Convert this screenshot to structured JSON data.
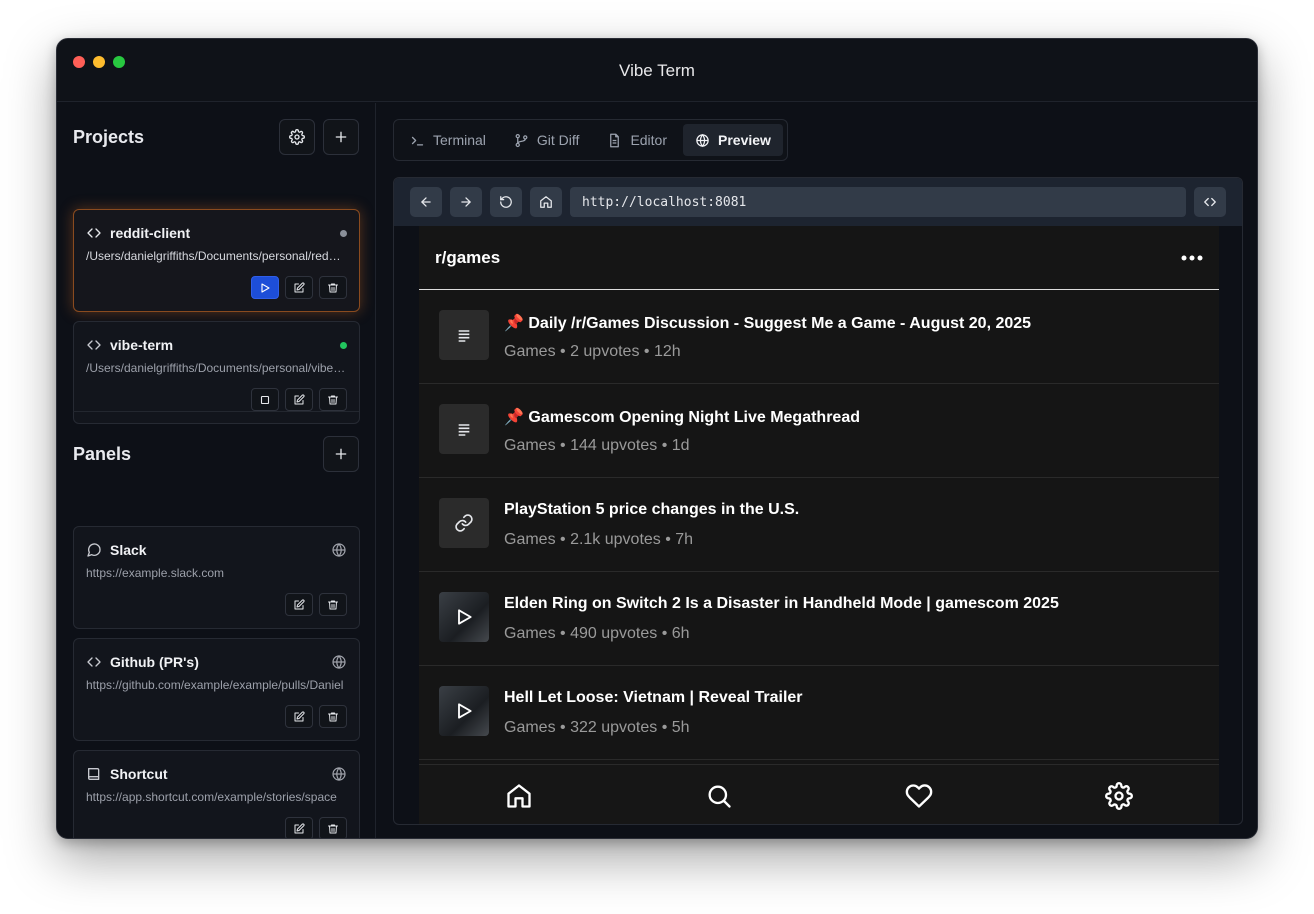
{
  "window": {
    "title": "Vibe Term",
    "traffic_lights": [
      {
        "name": "close",
        "color": "#ff5f57"
      },
      {
        "name": "minimize",
        "color": "#febc2e"
      },
      {
        "name": "zoom",
        "color": "#28c840"
      }
    ]
  },
  "sidebar": {
    "projects": {
      "title": "Projects",
      "settings_icon": "gear-icon",
      "add_icon": "plus-icon",
      "items": [
        {
          "name": "reddit-client",
          "path": "/Users/danielgriffiths/Documents/personal/reddit-client",
          "status_color": "#8a8f99",
          "active": true,
          "run_icon": "play-icon"
        },
        {
          "name": "vibe-term",
          "path": "/Users/danielgriffiths/Documents/personal/vibe-term",
          "status_color": "#22c55e",
          "active": false,
          "run_icon": "stop-icon"
        }
      ]
    },
    "panels": {
      "title": "Panels",
      "add_icon": "plus-icon",
      "items": [
        {
          "name": "Slack",
          "url": "https://example.slack.com",
          "icon": "chat-bubble-icon"
        },
        {
          "name": "Github (PR's)",
          "url": "https://github.com/example/example/pulls/Daniel",
          "icon": "code-icon"
        },
        {
          "name": "Shortcut",
          "url": "https://app.shortcut.com/example/stories/space",
          "icon": "book-icon"
        }
      ]
    }
  },
  "tabs": [
    {
      "label": "Terminal",
      "icon": "terminal-icon",
      "active": false
    },
    {
      "label": "Git Diff",
      "icon": "git-branch-icon",
      "active": false
    },
    {
      "label": "Editor",
      "icon": "file-icon",
      "active": false
    },
    {
      "label": "Preview",
      "icon": "globe-icon",
      "active": true
    }
  ],
  "browser": {
    "url": "http://localhost:8081",
    "back_icon": "arrow-left-icon",
    "forward_icon": "arrow-right-icon",
    "reload_icon": "reload-icon",
    "home_icon": "home-icon",
    "devtools_icon": "code-icon"
  },
  "app": {
    "subreddit": "r/games",
    "menu_icon": "more-icon",
    "posts": [
      {
        "title": "📌 Daily /r/Games Discussion - Suggest Me a Game - August 20, 2025",
        "meta": "Games • 2 upvotes • 12h",
        "thumb": "text-post-icon"
      },
      {
        "title": "📌 Gamescom Opening Night Live Megathread",
        "meta": "Games • 144 upvotes • 1d",
        "thumb": "text-post-icon"
      },
      {
        "title": "PlayStation 5 price changes in the U.S.",
        "meta": "Games • 2.1k upvotes • 7h",
        "thumb": "link-icon"
      },
      {
        "title": "Elden Ring on Switch 2 Is a Disaster in Handheld Mode | gamescom 2025",
        "meta": "Games • 490 upvotes • 6h",
        "thumb": "video-play-icon"
      },
      {
        "title": "Hell Let Loose: Vietnam | Reveal Trailer",
        "meta": "Games • 322 upvotes • 5h",
        "thumb": "video-play-icon"
      }
    ],
    "tabbar": [
      {
        "icon": "home-icon"
      },
      {
        "icon": "search-icon"
      },
      {
        "icon": "heart-icon"
      },
      {
        "icon": "gear-icon"
      }
    ]
  },
  "colors": {
    "accent": "#1d4ed8",
    "active_glow": "#ea7828",
    "running": "#22c55e"
  }
}
